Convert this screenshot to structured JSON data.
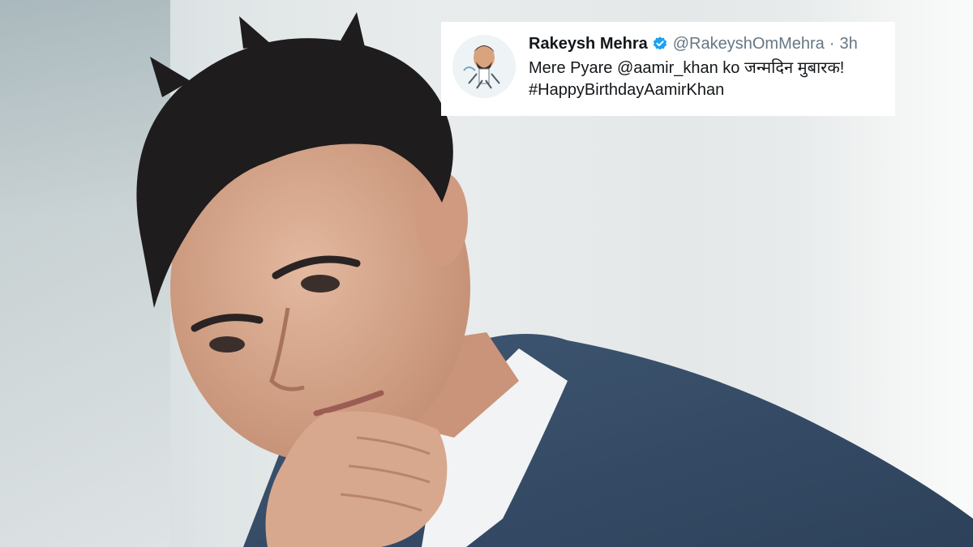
{
  "photo": {
    "subject_icon": "portrait-photo"
  },
  "tweet": {
    "author_name": "Rakeysh Mehra",
    "verified_icon": "verified-badge-icon",
    "handle": "@RakeyshOmMehra",
    "separator": "·",
    "time": "3h",
    "line1_prefix": "Mere Pyare ",
    "mention": "@aamir_khan",
    "line1_suffix": " ko जन्मदिन मुबारक!",
    "hashtag": "#HappyBirthdayAamirKhan",
    "avatar_icon": "caricature-avatar",
    "accent_color": "#1da1f2"
  }
}
